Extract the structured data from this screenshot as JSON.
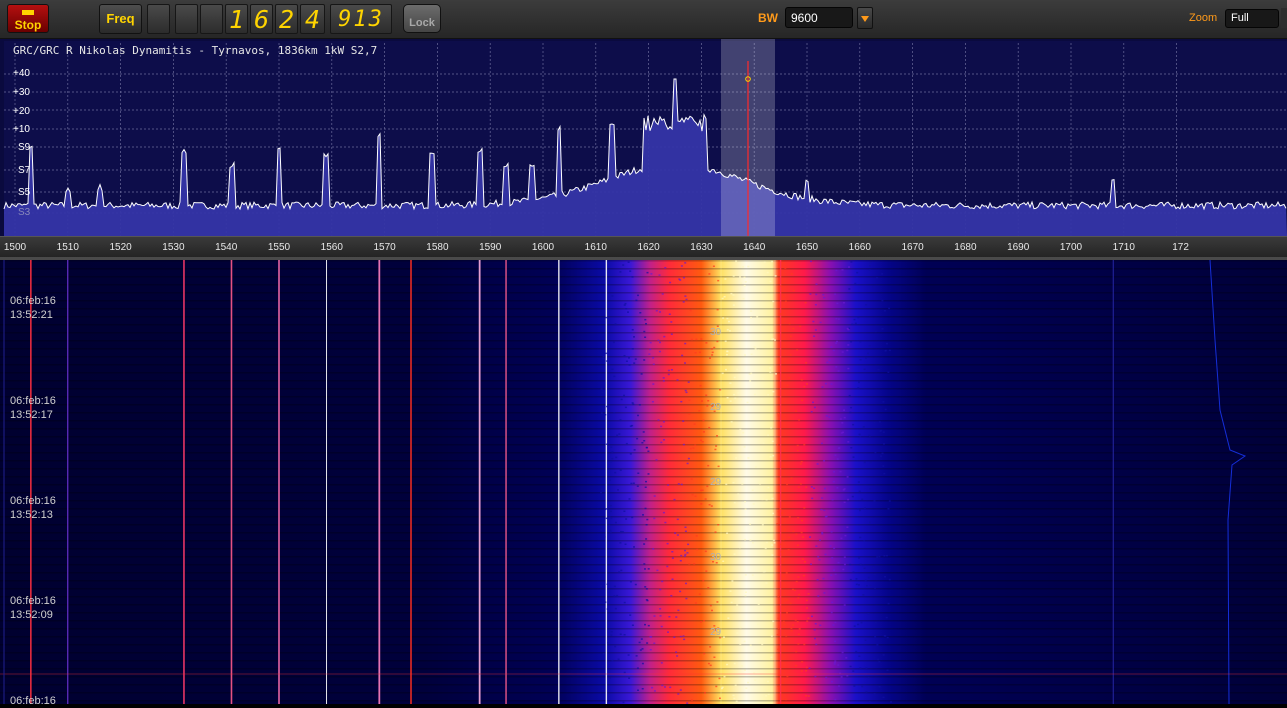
{
  "toolbar": {
    "stop_label": "Stop",
    "freq_label": "Freq",
    "digits": [
      "",
      "",
      "",
      "1",
      "6",
      "2",
      "4"
    ],
    "sub_digits": "913",
    "lock_label": "Lock",
    "bw_label": "BW",
    "bw_value": "9600",
    "zoom_label": "Zoom",
    "zoom_value": "Full"
  },
  "spectrum": {
    "station_info": "GRC/GRC R Nikolas Dynamitis - Tyrnavos, 1836km 1kW S2,7",
    "level_labels": [
      "+40",
      "+30",
      "+20",
      "+10",
      "S9",
      "S7",
      "S5",
      "S3"
    ],
    "freq_ticks": [
      "1500",
      "1510",
      "1520",
      "1530",
      "1540",
      "1550",
      "1560",
      "1570",
      "1580",
      "1590",
      "1600",
      "1610",
      "1620",
      "1630",
      "1640",
      "1650",
      "1660",
      "1670",
      "1680",
      "1690",
      "1700",
      "1710",
      "172"
    ],
    "tuned_freq_khz": 1624.913,
    "passband_khz": [
      1620,
      1630
    ]
  },
  "waterfall": {
    "timestamps": [
      {
        "date": "06:feb:16",
        "time": "13:52:21"
      },
      {
        "date": "06:feb:16",
        "time": "13:52:17"
      },
      {
        "date": "06:feb:16",
        "time": "13:52:13"
      },
      {
        "date": "06:feb:16",
        "time": "13:52:09"
      },
      {
        "date": "06:feb:16",
        "time": ""
      }
    ],
    "markers": [
      "30",
      "29",
      "29",
      "30",
      "29"
    ]
  },
  "colors": {
    "accent": "#ffd400",
    "label_orange": "#ff9a1a",
    "stop_red": "#b51010",
    "spectrum_bg": "#0c0c45",
    "spectrum_fill": "#3a3ab0",
    "waterfall_bg": "#000040"
  }
}
